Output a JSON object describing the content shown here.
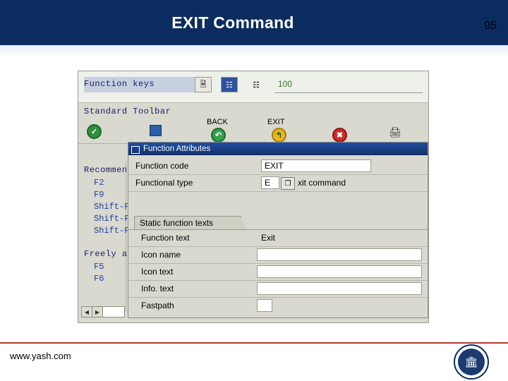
{
  "slide": {
    "title": "EXIT Command",
    "number": "95",
    "footer_url": "www.yash.com",
    "logo_icon": "institution-seal-icon"
  },
  "screen": {
    "function_keys": {
      "label": "Function keys",
      "field_value": "",
      "toolbar_icons": [
        "page-icon",
        "blue-book-icon",
        "layout-icon"
      ],
      "value": "100"
    },
    "standard_toolbar": {
      "label": "Standard Toolbar",
      "cells": [
        {
          "caption": "",
          "icon": "green-check-icon",
          "icon_char": "✔"
        },
        {
          "caption": "",
          "icon": "save-disk-icon",
          "icon_char": "▣"
        },
        {
          "caption": "BACK",
          "icon": "back-green-arrow-icon",
          "icon_char": "↶"
        },
        {
          "caption": "EXIT",
          "icon": "exit-yellow-arrow-icon",
          "icon_char": "↰"
        },
        {
          "caption": "",
          "icon": "cancel-red-x-icon",
          "icon_char": "✖"
        },
        {
          "caption": "",
          "icon": "print-icon",
          "icon_char": "⎙"
        }
      ]
    },
    "recommendation": {
      "label": "Recommen",
      "keys": [
        "F2",
        "F9",
        "Shift-F",
        "Shift-F",
        "Shift-F"
      ]
    },
    "freely": {
      "label": "Freely a",
      "keys": [
        "F5",
        "F6"
      ]
    },
    "scroll": {
      "left_arrow": "◀",
      "right_arrow": "▶"
    }
  },
  "dialog": {
    "title": "Function Attributes",
    "title_icon": "window-icon",
    "fields": [
      {
        "label": "Function code",
        "value": "EXIT"
      },
      {
        "label": "Functional type",
        "value": "E",
        "suffix": "xit command",
        "button_icon": "f4-help-icon",
        "button_char": "❐"
      }
    ],
    "tab": {
      "label": "Static function texts"
    },
    "text_fields": [
      {
        "label": "Function text",
        "value": "Exit"
      },
      {
        "label": "Icon name",
        "value": ""
      },
      {
        "label": "Icon text",
        "value": ""
      },
      {
        "label": "Info. text",
        "value": ""
      },
      {
        "label": "Fastpath",
        "value": ""
      }
    ]
  },
  "colors": {
    "banner": "#0b2c5e",
    "accent_rule": "#b03a2e",
    "dialog_title": "#1f4f9e",
    "sap_label_blue": "#1a1a6e",
    "sap_key_blue": "#1a3fa0",
    "green_value": "#2f7a2f"
  }
}
